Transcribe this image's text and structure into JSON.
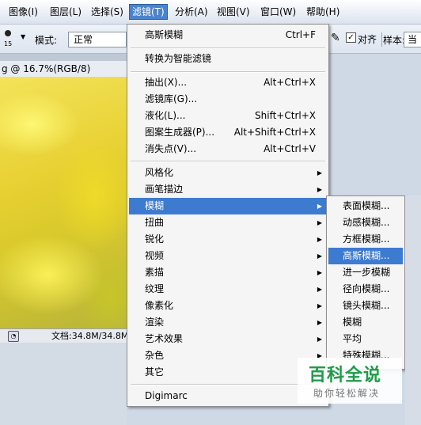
{
  "menubar": {
    "items": [
      {
        "label": "图像(I)"
      },
      {
        "label": "图层(L)"
      },
      {
        "label": "选择(S)"
      },
      {
        "label": "滤镜(T)"
      },
      {
        "label": "分析(A)"
      },
      {
        "label": "视图(V)"
      },
      {
        "label": "窗口(W)"
      },
      {
        "label": "帮助(H)"
      }
    ]
  },
  "options": {
    "brush_size": "15",
    "mode_label": "模式:",
    "mode_value": "正常",
    "align_label": "对齐",
    "align_checked": true,
    "sample_label": "样本:",
    "sample_value": "当"
  },
  "document": {
    "title": "g @ 16.7%(RGB/8)",
    "status": "文档:34.8M/34.8M"
  },
  "filter_menu": {
    "last_filter": {
      "label": "高斯模糊",
      "shortcut": "Ctrl+F"
    },
    "smart": "转换为智能滤镜",
    "group1": [
      {
        "label": "抽出(X)...",
        "shortcut": "Alt+Ctrl+X"
      },
      {
        "label": "滤镜库(G)...",
        "shortcut": ""
      },
      {
        "label": "液化(L)...",
        "shortcut": "Shift+Ctrl+X"
      },
      {
        "label": "图案生成器(P)...",
        "shortcut": "Alt+Shift+Ctrl+X"
      },
      {
        "label": "消失点(V)...",
        "shortcut": "Alt+Ctrl+V"
      }
    ],
    "group2": [
      {
        "label": "风格化"
      },
      {
        "label": "画笔描边"
      },
      {
        "label": "模糊"
      },
      {
        "label": "扭曲"
      },
      {
        "label": "锐化"
      },
      {
        "label": "视频"
      },
      {
        "label": "素描"
      },
      {
        "label": "纹理"
      },
      {
        "label": "像素化"
      },
      {
        "label": "渲染"
      },
      {
        "label": "艺术效果"
      },
      {
        "label": "杂色"
      },
      {
        "label": "其它"
      }
    ],
    "digimarc": "Digimarc",
    "highlighted": "模糊"
  },
  "blur_submenu": {
    "items": [
      {
        "label": "表面模糊..."
      },
      {
        "label": "动感模糊..."
      },
      {
        "label": "方框模糊..."
      },
      {
        "label": "高斯模糊..."
      },
      {
        "label": "进一步模糊"
      },
      {
        "label": "径向模糊..."
      },
      {
        "label": "镜头模糊..."
      },
      {
        "label": "模糊"
      },
      {
        "label": "平均"
      },
      {
        "label": "特殊模糊..."
      }
    ],
    "highlighted": "高斯模糊..."
  },
  "watermark": {
    "title": "百科全说",
    "subtitle": "助你轻松解决"
  },
  "colors": {
    "highlight": "#3d7bd0",
    "watermark_green": "#1e9b4a"
  }
}
